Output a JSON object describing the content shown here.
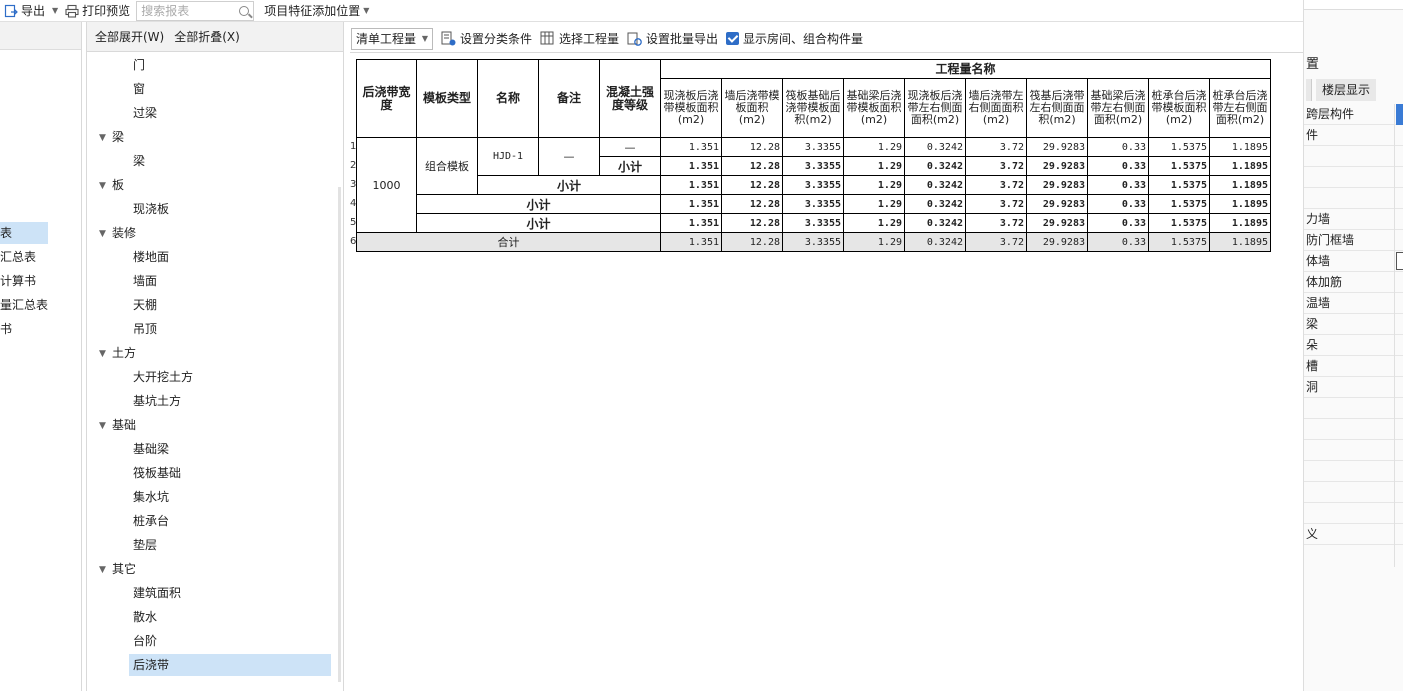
{
  "toolbar": {
    "export": "导出",
    "print_preview": "打印预览",
    "search_placeholder": "搜索报表",
    "feature_position": "项目特征添加位置"
  },
  "left_strip": {
    "items": [
      {
        "label": "表",
        "selected": true
      },
      {
        "label": "汇总表",
        "selected": false
      },
      {
        "label": "计算书",
        "selected": false
      },
      {
        "label": "量汇总表",
        "selected": false
      },
      {
        "label": "书",
        "selected": false
      }
    ]
  },
  "tree_panel": {
    "expand_all": "全部展开(W)",
    "collapse_all": "全部折叠(X)",
    "nodes": [
      {
        "label": "门",
        "level": 1
      },
      {
        "label": "窗",
        "level": 1
      },
      {
        "label": "过梁",
        "level": 1
      },
      {
        "label": "梁",
        "level": 0
      },
      {
        "label": "梁",
        "level": 1
      },
      {
        "label": "板",
        "level": 0
      },
      {
        "label": "现浇板",
        "level": 1
      },
      {
        "label": "装修",
        "level": 0
      },
      {
        "label": "楼地面",
        "level": 1
      },
      {
        "label": "墙面",
        "level": 1
      },
      {
        "label": "天棚",
        "level": 1
      },
      {
        "label": "吊顶",
        "level": 1
      },
      {
        "label": "土方",
        "level": 0
      },
      {
        "label": "大开挖土方",
        "level": 1
      },
      {
        "label": "基坑土方",
        "level": 1
      },
      {
        "label": "基础",
        "level": 0
      },
      {
        "label": "基础梁",
        "level": 1
      },
      {
        "label": "筏板基础",
        "level": 1
      },
      {
        "label": "集水坑",
        "level": 1
      },
      {
        "label": "桩承台",
        "level": 1
      },
      {
        "label": "垫层",
        "level": 1
      },
      {
        "label": "其它",
        "level": 0
      },
      {
        "label": "建筑面积",
        "level": 1
      },
      {
        "label": "散水",
        "level": 1
      },
      {
        "label": "台阶",
        "level": 1
      },
      {
        "label": "后浇带",
        "level": 1,
        "selected": true
      }
    ]
  },
  "main_toolbar": {
    "mode_select": "清单工程量",
    "set_category": "设置分类条件",
    "select_quantity": "选择工程量",
    "batch_export": "设置批量导出",
    "show_rooms": "显示房间、组合构件量"
  },
  "report": {
    "headers": {
      "width": "后浇带宽度",
      "formwork_type": "模板类型",
      "name": "名称",
      "remark": "备注",
      "concrete_grade": "混凝土强度等级",
      "quantity_group": "工程量名称",
      "columns": [
        "现浇板后浇带模板面积(m2)",
        "墙后浇带模板面积(m2)",
        "筏板基础后浇带模板面积(m2)",
        "基础梁后浇带模板面积(m2)",
        "现浇板后浇带左右侧面面积(m2)",
        "墙后浇带左右侧面面积(m2)",
        "筏基后浇带左右侧面面积(m2)",
        "基础梁后浇带左右侧面面积(m2)",
        "桩承台后浇带模板面积(m2)",
        "桩承台后浇带左右侧面面积(m2)"
      ]
    },
    "row_numbers": [
      "1",
      "2",
      "3",
      "4",
      "5",
      "6"
    ],
    "width_value": "1000",
    "formwork_value": "组合模板",
    "name_value": "HJD-1",
    "remark_value": "—",
    "grade_value": "—",
    "subtotal_label": "小计",
    "total_label": "合计",
    "values": [
      "1.351",
      "12.28",
      "3.3355",
      "1.29",
      "0.3242",
      "3.72",
      "29.9283",
      "0.33",
      "1.5375",
      "1.1895"
    ]
  },
  "right_panel": {
    "title": "置",
    "tab": "楼层显示",
    "rows": [
      "跨层构件",
      "件",
      "",
      "",
      "",
      "力墙",
      "防门框墙",
      "体墙",
      "体加筋",
      "温墙",
      "梁",
      "朵",
      "槽",
      "洞",
      "",
      "",
      "",
      "",
      "",
      "",
      "义"
    ]
  },
  "colors": {
    "selection": "#cde3f7",
    "accent": "#2e6dc7",
    "total_row": "#e6e6e6"
  }
}
